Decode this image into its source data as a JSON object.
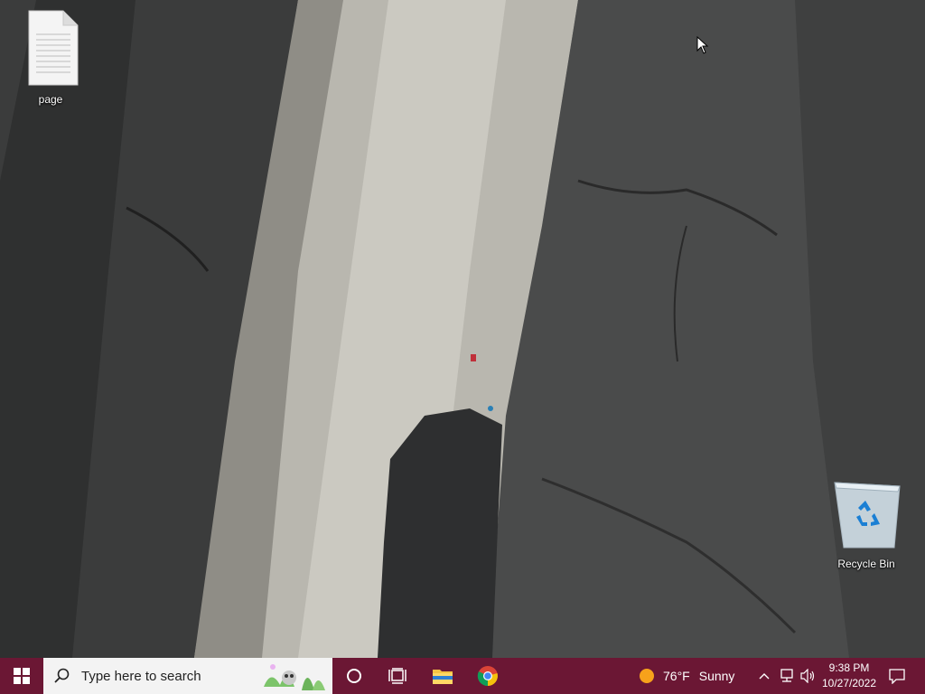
{
  "desktop": {
    "icons": [
      {
        "label": "page",
        "icon": "text-file-icon"
      },
      {
        "label": "Recycle Bin",
        "icon": "recycle-bin-icon"
      }
    ]
  },
  "taskbar": {
    "search_placeholder": "Type here to search",
    "pinned": [
      {
        "name": "Cortana",
        "icon": "cortana-icon"
      },
      {
        "name": "Task View",
        "icon": "task-view-icon"
      },
      {
        "name": "File Explorer",
        "icon": "folder-icon"
      },
      {
        "name": "Google Chrome",
        "icon": "chrome-icon"
      }
    ],
    "weather": {
      "temp": "76°F",
      "condition": "Sunny"
    },
    "clock": {
      "time": "9:38 PM",
      "date": "10/27/2022"
    },
    "color": "#6b1734"
  }
}
